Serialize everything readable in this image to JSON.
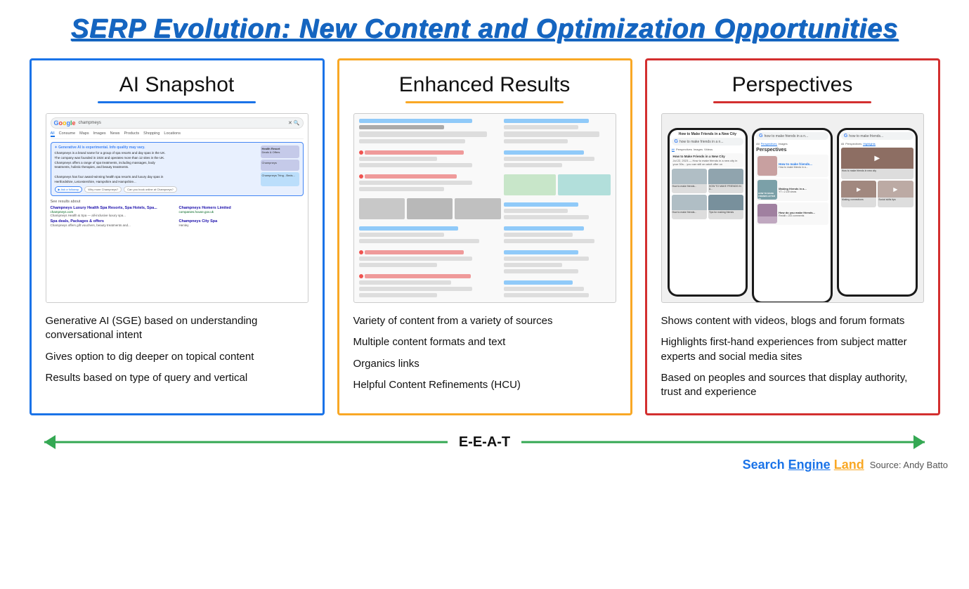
{
  "page": {
    "title": "SERP Evolution: New Content and Optimization Opportunities"
  },
  "cards": [
    {
      "id": "ai-snapshot",
      "title": "AI Snapshot",
      "border_color": "blue",
      "underline_color": "blue",
      "bullets": [
        "Generative AI (SGE) based on understanding conversational  intent",
        "Gives option to dig deeper on topical content",
        "Results based on type of query and vertical"
      ]
    },
    {
      "id": "enhanced-results",
      "title": "Enhanced Results",
      "border_color": "yellow",
      "underline_color": "yellow",
      "bullets": [
        "Variety of content from a variety of sources",
        "Multiple content formats and text",
        "Organics links",
        "Helpful Content Refinements (HCU)"
      ]
    },
    {
      "id": "perspectives",
      "title": "Perspectives",
      "border_color": "red",
      "underline_color": "red",
      "bullets": [
        "Shows content with videos, blogs and forum formats",
        "Highlights first-hand experiences from subject matter experts and social media sites",
        "Based on peoples and sources that display authority, trust and experience"
      ]
    }
  ],
  "bottom": {
    "eeat_label": "E-E-A-T"
  },
  "footer": {
    "logo_search": "Search",
    "logo_engine": "Engine",
    "logo_land": "Land",
    "source_text": "Source: Andy Batto"
  }
}
